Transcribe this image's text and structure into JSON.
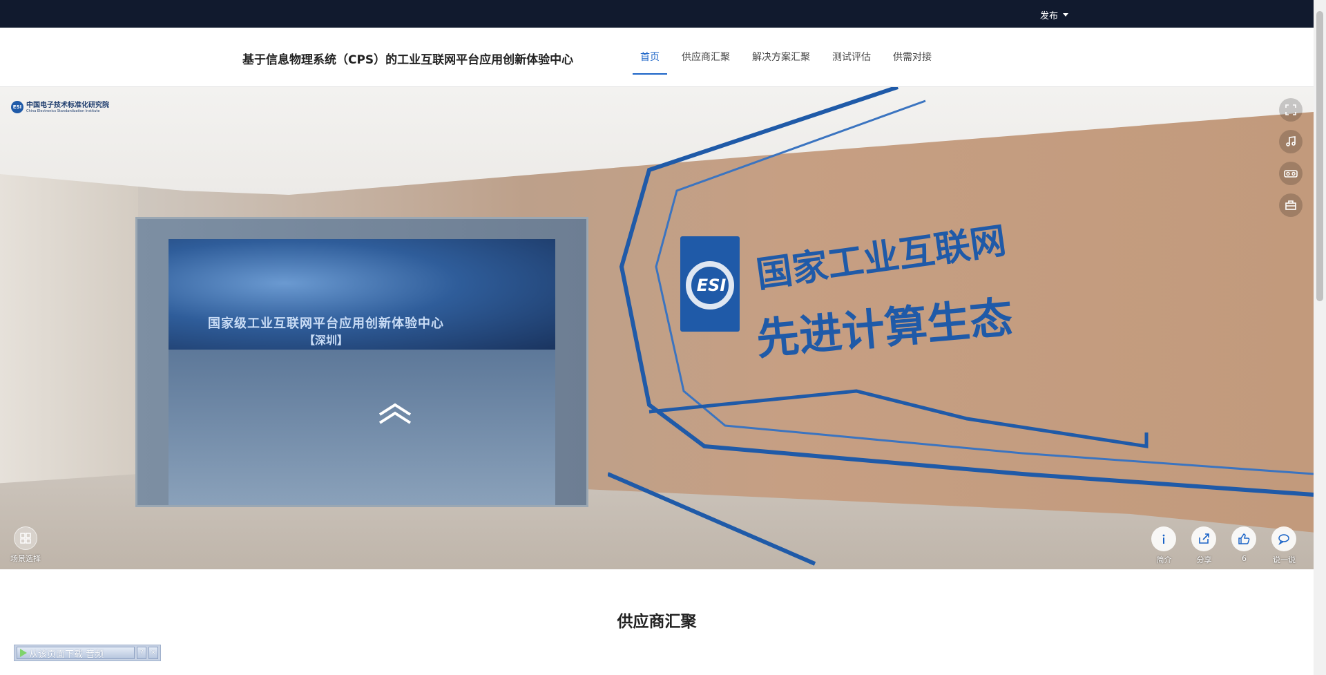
{
  "topbar": {
    "publish_label": "发布"
  },
  "header": {
    "site_title": "基于信息物理系统（CPS）的工业互联网平台应用创新体验中心",
    "nav": [
      {
        "label": "首页",
        "active": true
      },
      {
        "label": "供应商汇聚",
        "active": false
      },
      {
        "label": "解决方案汇聚",
        "active": false
      },
      {
        "label": "测试评估",
        "active": false
      },
      {
        "label": "供需对接",
        "active": false
      }
    ]
  },
  "panorama": {
    "logo_name": "中国电子技术标准化研究院",
    "logo_en": "China Electronics Standardization Institute",
    "logo_mark": "ESI",
    "screen_text": "国家级工业互联网平台应用创新体验中心",
    "screen_sub": "【深圳】",
    "wall_text_1": "国家工业互联网",
    "wall_text_2": "先进计算生态",
    "wall_logo": "ESI",
    "side_tools": [
      "fullscreen-icon",
      "music-icon",
      "vr-glasses-icon",
      "toolbox-icon"
    ],
    "scene_select_label": "场景选择",
    "bottom_tools": [
      {
        "icon": "info-icon",
        "label": "简介"
      },
      {
        "icon": "share-icon",
        "label": "分享"
      },
      {
        "icon": "thumbs-up-icon",
        "label": "6"
      },
      {
        "icon": "comment-icon",
        "label": "说一说"
      }
    ]
  },
  "section": {
    "title": "供应商汇聚"
  },
  "download_bar": {
    "label": "从该页面下载 音频",
    "help": "?",
    "close": "×"
  },
  "colors": {
    "topbar": "#111a2e",
    "accent": "#1a63c7",
    "brand_blue": "#1f5aa8"
  }
}
